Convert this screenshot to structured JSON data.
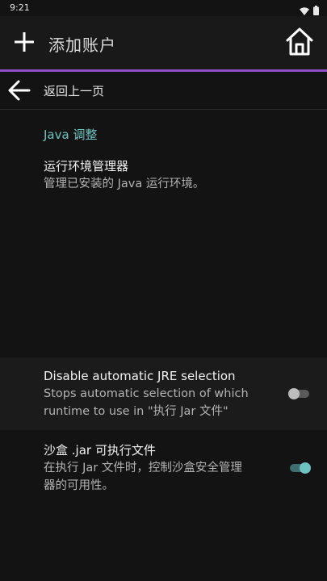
{
  "status_bar": {
    "time": "9:21",
    "icons": [
      "wifi-icon",
      "battery-icon"
    ]
  },
  "app_bar": {
    "title": "添加账户",
    "add_icon": "plus-icon",
    "home_icon": "home-icon",
    "accent_color": "#8e4ec8"
  },
  "back_row": {
    "label": "返回上一页",
    "icon": "arrow-left-icon"
  },
  "section": {
    "title": "Java 调整",
    "title_color": "#6cc3c2"
  },
  "prefs": {
    "runtime_manager": {
      "title": "运行环境管理器",
      "summary": "管理已安装的 Java 运行环境。"
    },
    "disable_auto_jre": {
      "title": "Disable automatic JRE selection",
      "summary_line1": "Stops automatic selection of which",
      "summary_line2": "runtime to use in \"执行 Jar 文件\"",
      "enabled": false
    },
    "sandbox_jar": {
      "title": "沙盒 .jar 可执行文件",
      "summary_line1": "在执行 Jar 文件时，控制沙盒安全管理",
      "summary_line2": "器的可用性。",
      "enabled": true
    }
  },
  "colors": {
    "switch_on_thumb": "#6cc3c2",
    "switch_on_track": "#3e6f6e",
    "switch_off_thumb": "#bdbdbd",
    "switch_off_track": "#5a5a5a"
  }
}
